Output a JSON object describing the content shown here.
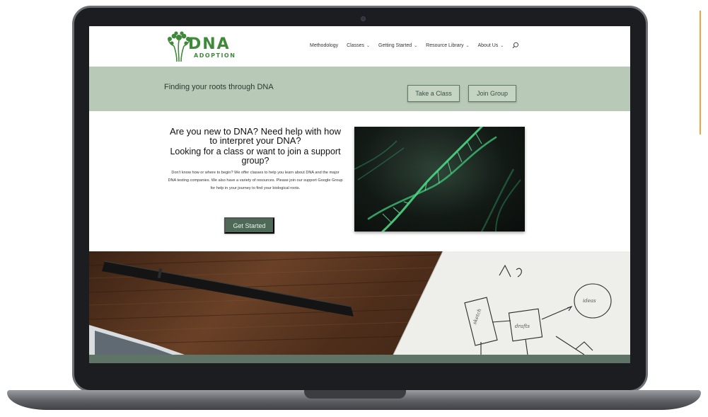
{
  "site": {
    "logo": {
      "word": "DNA",
      "sub": "ADOPTION"
    },
    "nav": [
      {
        "label": "Methodology",
        "dropdown": false
      },
      {
        "label": "Classes",
        "dropdown": true
      },
      {
        "label": "Getting Started",
        "dropdown": true
      },
      {
        "label": "Resource Library",
        "dropdown": true
      },
      {
        "label": "About Us",
        "dropdown": true
      }
    ],
    "search_icon": "search-icon"
  },
  "hero": {
    "tagline": "Finding your roots through DNA",
    "take_class_label": "Take a Class",
    "join_group_label": "Join Group"
  },
  "intro": {
    "heading_1": "Are you new to DNA? Need help with how to interpret your DNA?",
    "heading_2": "Looking for a class or want to join a support group?",
    "body": "Don't know how or where to begin? We offer classes to help you learn about DNA and the major DNA testing companies. We also have a variety of resources. Please join our support Google Group for help in your journey to find your biological roots.",
    "cta_label": "Get Started"
  },
  "colors": {
    "brand_green": "#3f8a3a",
    "band": "#b8c9b7",
    "cta": "#4d6a58",
    "accent_line": "#f2a33a"
  }
}
